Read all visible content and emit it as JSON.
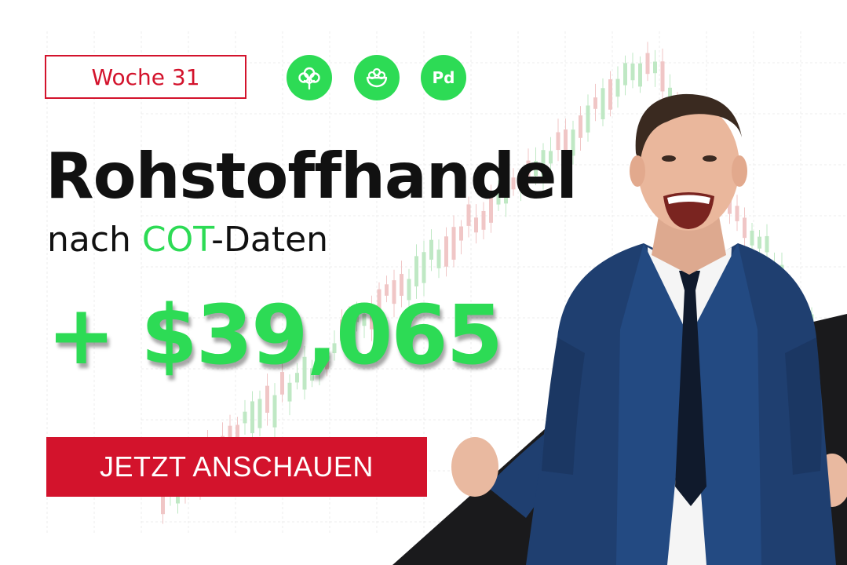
{
  "week_badge": {
    "label": "Woche 31"
  },
  "commodity_icons": [
    {
      "icon": "cotton-icon"
    },
    {
      "icon": "grain-bowl-icon"
    },
    {
      "icon": "palladium-icon",
      "label": "Pd"
    }
  ],
  "headline": {
    "title": "Rohstoffhandel",
    "subtitle_prefix": "nach ",
    "subtitle_accent": "COT",
    "subtitle_suffix": "-Daten"
  },
  "amount": {
    "value": "+ $39,065"
  },
  "cta": {
    "label": "JETZT ANSCHAUEN"
  },
  "colors": {
    "accent_green": "#2ddb55",
    "brand_red": "#d3132c",
    "text_dark": "#111111",
    "suit_blue": "#1f3f70",
    "dark_triangle": "#1a1a1c"
  }
}
